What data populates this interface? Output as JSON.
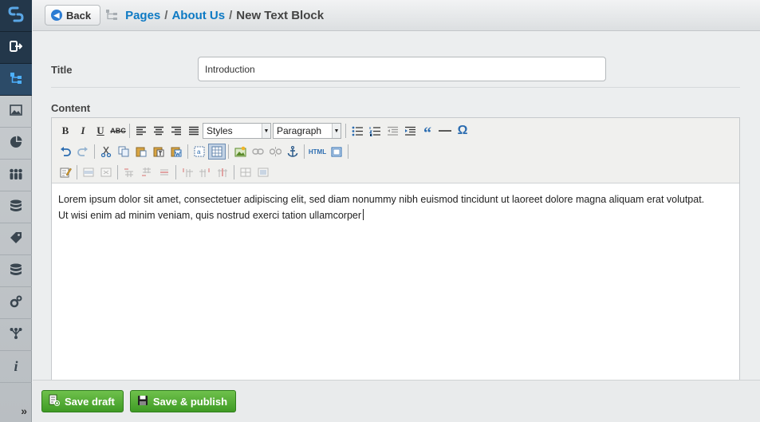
{
  "rail": {
    "items": [
      "logo-icon",
      "logout-icon",
      "pages-icon",
      "files-icon",
      "reports-icon",
      "security-icon",
      "database-icon",
      "tags-icon",
      "database-alt-icon",
      "settings-icon",
      "sitetree-icon",
      "help-icon"
    ],
    "expand_label": "»"
  },
  "header": {
    "back_label": "Back",
    "breadcrumb": {
      "pages": "Pages",
      "sep1": "/",
      "about": "About Us",
      "sep2": "/",
      "current": "New Text Block"
    }
  },
  "form": {
    "title_label": "Title",
    "title_value": "Introduction",
    "content_label": "Content"
  },
  "editor": {
    "styles_select": "Styles",
    "format_select": "Paragraph",
    "html_label": "HTML",
    "line1": "Lorem ipsum dolor sit amet, consectetuer adipiscing elit, sed diam nonummy nibh euismod tincidunt ut laoreet dolore magna aliquam erat volutpat.",
    "line2": "Ut wisi enim ad minim veniam, quis nostrud exerci tation ullamcorper"
  },
  "footer": {
    "save_draft_label": "Save draft",
    "save_publish_label": "Save & publish"
  },
  "colors": {
    "rail_dark": "#23374a",
    "rail_active": "#2c4b68",
    "link_blue": "#0e7ac4",
    "button_green": "#4aa62e"
  }
}
